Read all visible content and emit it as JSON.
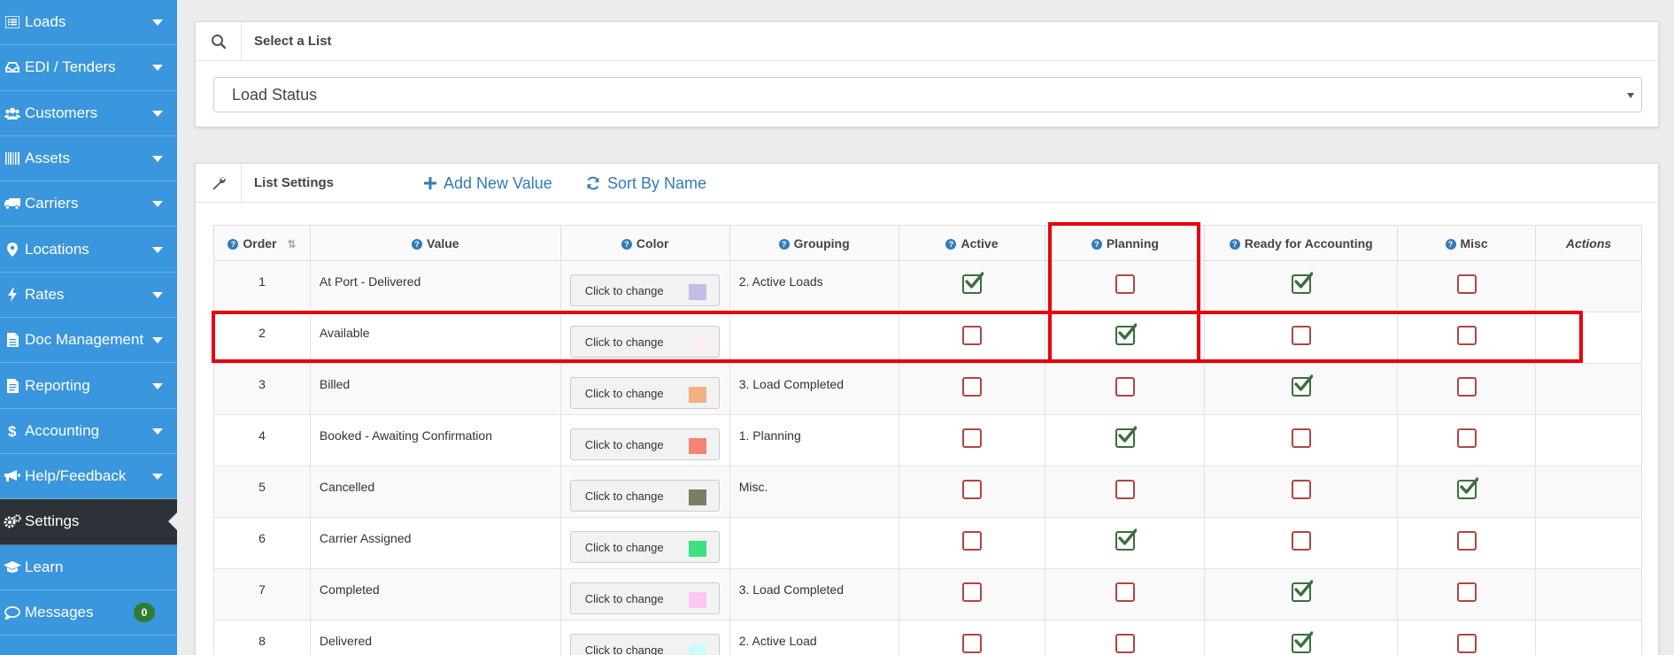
{
  "sidebar": {
    "items": [
      {
        "label": "Loads",
        "icon": "list-icon",
        "caret": true
      },
      {
        "label": "EDI / Tenders",
        "icon": "inbox-icon",
        "caret": true
      },
      {
        "label": "Customers",
        "icon": "users-icon",
        "caret": true
      },
      {
        "label": "Assets",
        "icon": "barcode-icon",
        "caret": true
      },
      {
        "label": "Carriers",
        "icon": "truck-icon",
        "caret": true
      },
      {
        "label": "Locations",
        "icon": "map-marker-icon",
        "caret": true
      },
      {
        "label": "Rates",
        "icon": "bolt-icon",
        "caret": true
      },
      {
        "label": "Doc Management",
        "icon": "file-icon",
        "caret": true
      },
      {
        "label": "Reporting",
        "icon": "file-text-icon",
        "caret": true
      },
      {
        "label": "Accounting",
        "icon": "dollar-icon",
        "caret": true
      },
      {
        "label": "Help/Feedback",
        "icon": "bullhorn-icon",
        "caret": true
      },
      {
        "label": "Settings",
        "icon": "gears-icon",
        "active": true
      },
      {
        "label": "Learn",
        "icon": "graduation-cap-icon"
      },
      {
        "label": "Messages",
        "icon": "comment-icon",
        "badge": "0"
      }
    ]
  },
  "select_panel": {
    "title": "Select a List",
    "selected_value": "Load Status"
  },
  "settings_panel": {
    "title": "List Settings",
    "add_label": "Add New Value",
    "sort_label": "Sort By Name"
  },
  "table": {
    "headers": {
      "order": "Order",
      "value": "Value",
      "color": "Color",
      "grouping": "Grouping",
      "active": "Active",
      "planning": "Planning",
      "ready": "Ready for Accounting",
      "misc": "Misc",
      "actions": "Actions"
    },
    "color_button_label": "Click to change",
    "rows": [
      {
        "order": "1",
        "value": "At Port - Delivered",
        "color": "#c5bde6",
        "grouping": "2. Active Loads",
        "active": true,
        "planning": false,
        "ready": true,
        "misc": false
      },
      {
        "order": "2",
        "value": "Available",
        "color": "#fbeef2",
        "grouping": "",
        "active": false,
        "planning": true,
        "ready": false,
        "misc": false
      },
      {
        "order": "3",
        "value": "Billed",
        "color": "#f4b083",
        "grouping": "3. Load Completed",
        "active": false,
        "planning": false,
        "ready": true,
        "misc": false
      },
      {
        "order": "4",
        "value": "Booked - Awaiting Confirmation",
        "color": "#f58473",
        "grouping": "1. Planning",
        "active": false,
        "planning": true,
        "ready": false,
        "misc": false
      },
      {
        "order": "5",
        "value": "Cancelled",
        "color": "#7d7d62",
        "grouping": "Misc.",
        "active": false,
        "planning": false,
        "ready": false,
        "misc": true
      },
      {
        "order": "6",
        "value": "Carrier Assigned",
        "color": "#3fe07f",
        "grouping": "",
        "active": false,
        "planning": true,
        "ready": false,
        "misc": false
      },
      {
        "order": "7",
        "value": "Completed",
        "color": "#fbc6f5",
        "grouping": "3. Load Completed",
        "active": false,
        "planning": false,
        "ready": true,
        "misc": false
      },
      {
        "order": "8",
        "value": "Delivered",
        "color": "#cdfbf7",
        "grouping": "2. Active Load",
        "active": false,
        "planning": false,
        "ready": true,
        "misc": false
      }
    ]
  }
}
